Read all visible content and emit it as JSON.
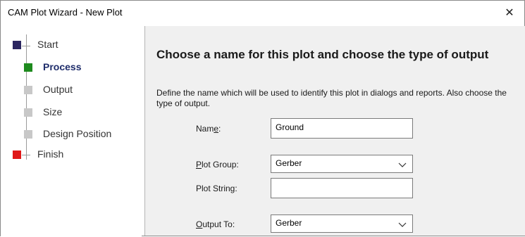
{
  "window": {
    "title": "CAM Plot  Wizard - New Plot",
    "close_glyph": "✕"
  },
  "steps": [
    {
      "label": "Start",
      "color": "#2b2660"
    },
    {
      "label": "Process",
      "color": "#1e8a1e",
      "active": true
    },
    {
      "label": "Output",
      "color": "#c8c8c8"
    },
    {
      "label": "Size",
      "color": "#c8c8c8"
    },
    {
      "label": "Design Position",
      "color": "#c8c8c8"
    },
    {
      "label": "Finish",
      "color": "#e01818"
    }
  ],
  "page": {
    "heading": "Choose a name for this plot and choose the type of output",
    "description": "Define the name which will be used to identify this plot in dialogs and reports. Also choose the type of output."
  },
  "form": {
    "name": {
      "label_u": "e",
      "label_pre": "Nam",
      "label_post": ":",
      "value": "Ground"
    },
    "plot_group": {
      "label_u": "P",
      "label_pre": "",
      "label_post": "lot Group:",
      "value": "Gerber"
    },
    "plot_string": {
      "label": "Plot String:",
      "value": ""
    },
    "output_to": {
      "label_u": "O",
      "label_pre": "",
      "label_post": "utput To:",
      "value": "Gerber"
    }
  }
}
